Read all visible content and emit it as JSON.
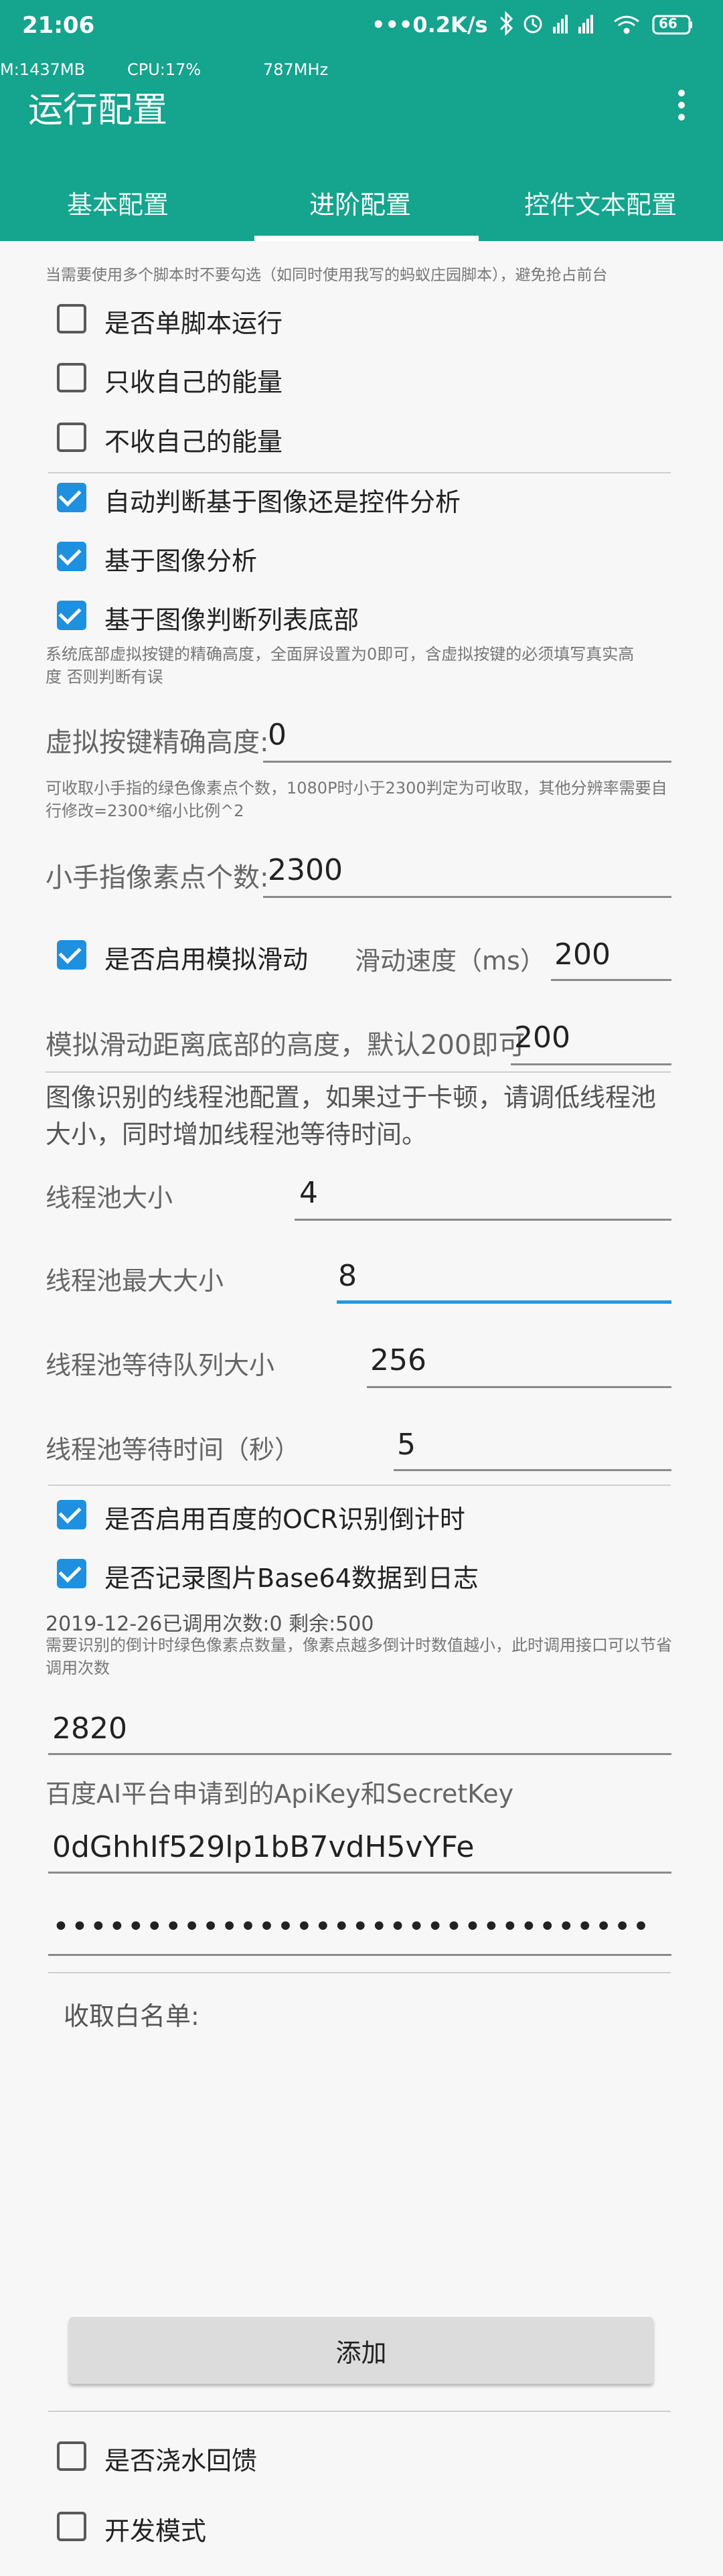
{
  "status_bar": {
    "time": "21:06",
    "net_speed": "•••0.2K/s",
    "icons": [
      "bluetooth-icon",
      "alarm-icon",
      "signal-hd-icon",
      "signal-icon",
      "wifi-icon",
      "battery-icon"
    ],
    "battery": "66"
  },
  "debug": {
    "mem": "M:1437MB",
    "cpu": "CPU:17%",
    "freq": "787MHz"
  },
  "app_bar": {
    "title": "运行配置",
    "more_icon": "more-vert-icon"
  },
  "tabs": [
    {
      "label": "基本配置",
      "active": false
    },
    {
      "label": "进阶配置",
      "active": true
    },
    {
      "label": "控件文本配置",
      "active": false
    }
  ],
  "hint_top": "当需要使用多个脚本时不要勾选（如同时使用我写的蚂蚁庄园脚本），避免抢占前台",
  "checkboxes_a": [
    {
      "label": "是否单脚本运行",
      "checked": false
    },
    {
      "label": "只收自己的能量",
      "checked": false
    },
    {
      "label": "不收自己的能量",
      "checked": false
    },
    {
      "label": "自动判断基于图像还是控件分析",
      "checked": true
    },
    {
      "label": "基于图像分析",
      "checked": true
    },
    {
      "label": "基于图像判断列表底部",
      "checked": true
    }
  ],
  "hint_virtual_key": "系统底部虚拟按键的精确高度，全面屏设置为0即可，含虚拟按键的必须填写真实高度 否则判断有误",
  "virtual_key": {
    "label": "虚拟按键精确高度:",
    "value": "0"
  },
  "hint_finger": "可收取小手指的绿色像素点个数，1080P时小于2300判定为可收取，其他分辨率需要自行修改=2300*缩小比例^2",
  "finger_pixels": {
    "label": "小手指像素点个数:",
    "value": "2300"
  },
  "simulate_slide": {
    "label": "是否启用模拟滑动",
    "checked": true,
    "speed_label": "滑动速度（ms）",
    "speed_value": "200"
  },
  "slide_bottom": {
    "label": "模拟滑动距离底部的高度，默认200即可",
    "value": "200"
  },
  "thread_hint": "图像识别的线程池配置，如果过于卡顿，请调低线程池大小，同时增加线程池等待时间。",
  "thread_pool": {
    "size": {
      "label": "线程池大小",
      "value": "4"
    },
    "max_size": {
      "label": "线程池最大大小",
      "value": "8"
    },
    "queue_size": {
      "label": "线程池等待队列大小",
      "value": "256"
    },
    "wait_time": {
      "label": "线程池等待时间（秒）",
      "value": "5"
    }
  },
  "checkboxes_b": [
    {
      "label": "是否启用百度的OCR识别倒计时",
      "checked": true
    },
    {
      "label": "是否记录图片Base64数据到日志",
      "checked": true
    }
  ],
  "ocr_usage": "2019-12-26已调用次数:0 剩余:500",
  "hint_countdown": "需要识别的倒计时绿色像素点数量，像素点越多倒计时数值越小，此时调用接口可以节省调用次数",
  "countdown_pixels": "2820",
  "apikey_label": "百度AI平台申请到的ApiKey和SecretKey",
  "api_key": "0dGhhIf529lp1bB7vdH5vYFe",
  "secret_key": "••••••••••••••••••••••••••••••••",
  "whitelist_label": "收取白名单:",
  "add_button": "添加",
  "checkboxes_c": [
    {
      "label": "是否浇水回馈",
      "checked": false
    },
    {
      "label": "开发模式",
      "checked": false
    }
  ]
}
